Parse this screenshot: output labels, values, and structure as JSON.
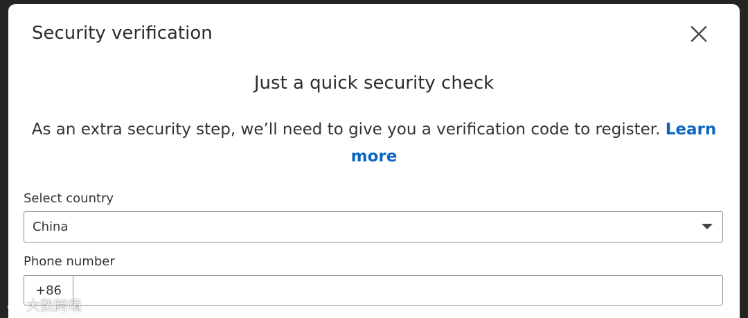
{
  "dialog": {
    "title": "Security verification",
    "heading": "Just a quick security check",
    "description": "As an extra security step, we’ll need to give you a verification code to register.",
    "learn_more": "Learn more"
  },
  "country": {
    "label": "Select country",
    "selected": "China"
  },
  "phone": {
    "label": "Phone number",
    "code": "+86",
    "value": ""
  },
  "watermark": {
    "text": "大数跨境"
  },
  "colors": {
    "link": "#0a66c2",
    "text": "#333333",
    "border": "#8c8c8c"
  },
  "icons": {
    "close": "close-icon",
    "caret": "chevron-down-icon",
    "watermark": "weibo-icon"
  }
}
